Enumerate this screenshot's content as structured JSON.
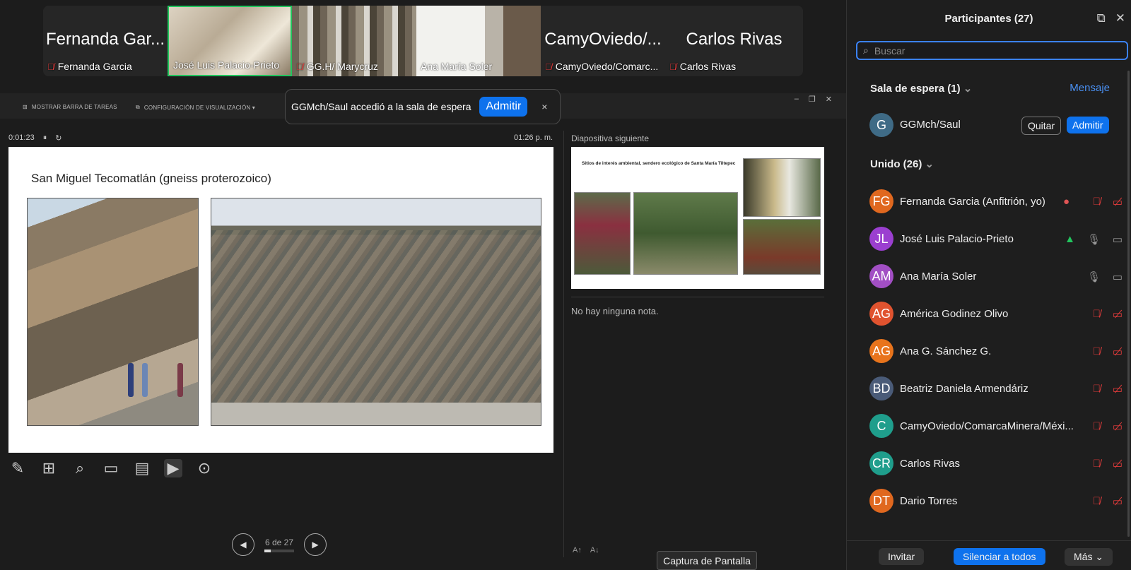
{
  "gallery": {
    "tiles": [
      {
        "big": "Fernanda Gar...",
        "name": "Fernanda Garcia",
        "muted": true
      },
      {
        "big": "",
        "name": "José Luis Palacio-Prieto",
        "muted": false
      },
      {
        "big": "",
        "name": "GG.H/ Marycruz",
        "muted": true
      },
      {
        "big": "",
        "name": "Ana María Soler",
        "muted": false
      },
      {
        "big": "CamyOviedo/...",
        "name": "CamyOviedo/Comarc...",
        "muted": true
      },
      {
        "big": "Carlos Rivas",
        "name": "Carlos Rivas",
        "muted": true
      }
    ]
  },
  "presenter": {
    "toolbar": {
      "taskbar": "MOSTRAR BARRA DE TAREAS",
      "display": "CONFIGURACIÓN DE VISUALIZACIÓN ▾"
    },
    "timer": "0:01:23",
    "clock": "01:26 p. m.",
    "slide_title": "San Miguel Tecomatlán (gneiss proterozoico)",
    "next_label": "Diapositiva siguiente",
    "next_title": "Sitios de interés ambiental, sendero ecológico de Santa María Tiltepec",
    "notes": "No hay ninguna nota.",
    "page": "6 de 27",
    "progress": 0.22
  },
  "toast": {
    "text": "GGMch/Saul accedió a la sala de espera",
    "admit": "Admitir",
    "close": "×"
  },
  "capture": "Captura de Pantalla",
  "panel": {
    "title": "Participantes (27)",
    "search_placeholder": "Buscar",
    "waiting_label": "Sala de espera (1)",
    "message": "Mensaje",
    "waiting_user": {
      "initial": "G",
      "name": "GGMch/Saul",
      "color": "#3f6b86"
    },
    "remove": "Quitar",
    "admit": "Admitir",
    "joined_label": "Unido (26)",
    "participants": [
      {
        "initials": "FG",
        "name": "Fernanda Garcia (Anfitrión, yo)",
        "color": "#e0681f",
        "mic": "muted",
        "cam": "off"
      },
      {
        "initials": "JL",
        "name": "José Luis Palacio-Prieto",
        "color": "#9b3fd0",
        "mic": "on",
        "cam": "on"
      },
      {
        "initials": "AM",
        "name": "Ana María Soler",
        "color": "#a24fc4",
        "mic": "on",
        "cam": "on"
      },
      {
        "initials": "AG",
        "name": "América Godinez Olivo",
        "color": "#e0532f",
        "mic": "muted",
        "cam": "off"
      },
      {
        "initials": "AG",
        "name": "Ana G. Sánchez G.",
        "color": "#e8741c",
        "mic": "muted",
        "cam": "off"
      },
      {
        "initials": "BD",
        "name": "Beatriz Daniela Armendáriz",
        "color": "#4a5b78",
        "mic": "muted",
        "cam": "off"
      },
      {
        "initials": "C",
        "name": "CamyOviedo/ComarcaMinera/Méxi...",
        "color": "#1f9e8c",
        "mic": "muted",
        "cam": "off"
      },
      {
        "initials": "CR",
        "name": "Carlos Rivas",
        "color": "#1f9e8c",
        "mic": "muted",
        "cam": "off"
      },
      {
        "initials": "DT",
        "name": "Dario Torres",
        "color": "#e0681f",
        "mic": "muted",
        "cam": "off"
      }
    ],
    "footer": {
      "invite": "Invitar",
      "mute_all": "Silenciar a todos",
      "more": "Más"
    }
  }
}
